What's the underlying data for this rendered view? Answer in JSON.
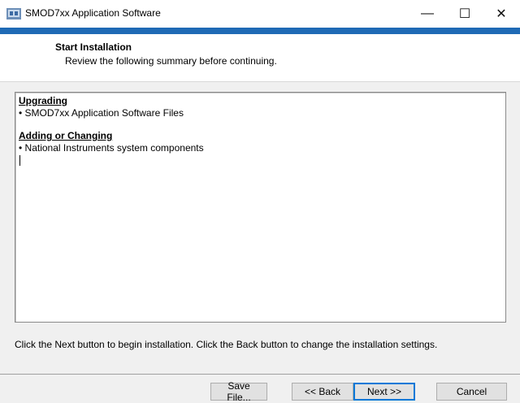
{
  "window": {
    "title": "SMOD7xx Application Software",
    "app_icon": "installer-icon",
    "controls": {
      "minimize": "—",
      "maximize": "☐",
      "close": "✕"
    }
  },
  "header": {
    "title": "Start Installation",
    "subtitle": "Review the following summary before continuing."
  },
  "summary": {
    "sections": [
      {
        "heading": "Upgrading",
        "items": [
          "• SMOD7xx Application Software Files"
        ]
      },
      {
        "heading": "Adding or Changing",
        "items": [
          "• National Instruments system components"
        ]
      }
    ]
  },
  "instructions": "Click the Next button to begin installation.  Click the Back button to change the installation settings.",
  "buttons": {
    "save_file": "Save File...",
    "back": "<< Back",
    "next": "Next >>",
    "cancel": "Cancel"
  },
  "colors": {
    "accent_band": "#1f6ab5",
    "default_button_border": "#0078d7"
  }
}
